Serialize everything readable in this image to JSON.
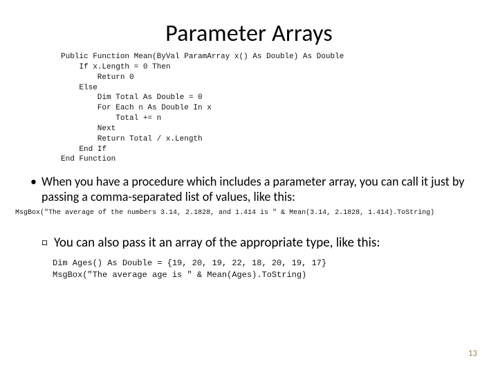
{
  "title": "Parameter Arrays",
  "code_main": "Public Function Mean(ByVal ParamArray x() As Double) As Double\n    If x.Length = 0 Then\n        Return 0\n    Else\n        Dim Total As Double = 0\n        For Each n As Double In x\n            Total += n\n        Next\n        Return Total / x.Length\n    End If\nEnd Function",
  "bullet1": "When you have a procedure which includes a parameter array, you can call it just by passing a comma-separated list of values, like this:",
  "code_line": "MsgBox(\"The average of the numbers 3.14, 2.1828, and 1.414 is \" & Mean(3.14, 2.1828, 1.414).ToString)",
  "bullet2": "You can also pass it an array of the appropriate type, like this:",
  "code_block2": "Dim Ages() As Double = {19, 20, 19, 22, 18, 20, 19, 17}\nMsgBox(\"The average age is \" & Mean(Ages).ToString)",
  "page_number": "13",
  "marks": {
    "dot": "•",
    "square": "□"
  }
}
